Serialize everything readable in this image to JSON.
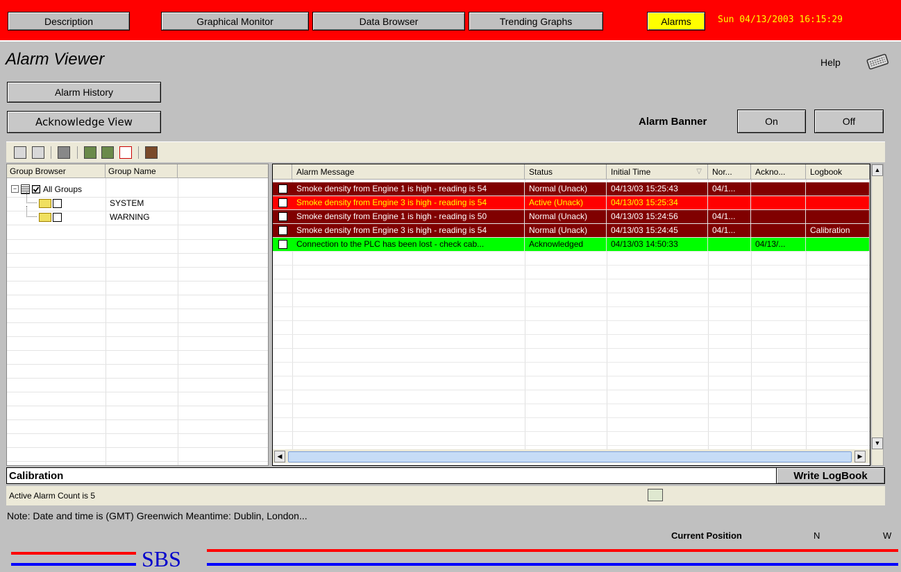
{
  "nav": {
    "tabs": [
      "Description",
      "Graphical Monitor",
      "Data Browser",
      "Trending Graphs"
    ],
    "alarms": "Alarms",
    "clock": "Sun 04/13/2003 16:15:29"
  },
  "header": {
    "title": "Alarm Viewer",
    "help": "Help",
    "alarm_history": "Alarm History",
    "acknowledge_view": "Acknowledge View",
    "alarm_banner": "Alarm Banner",
    "on": "On",
    "off": "Off"
  },
  "groups": {
    "headers": [
      "Group Browser",
      "Group Name"
    ],
    "root": "All Groups",
    "children": [
      "SYSTEM",
      "WARNING"
    ]
  },
  "alarms": {
    "headers": [
      "Alarm Message",
      "Status",
      "Initial Time",
      "Nor...",
      "Ackno...",
      "Logbook"
    ],
    "rows": [
      {
        "message": "Smoke density from Engine 1 is high - reading is 54",
        "status": "Normal (Unack)",
        "initial": "04/13/03 15:25:43",
        "normal": "04/1...",
        "ack": "",
        "logbook": "",
        "bg": "#800000",
        "fg": "#ffffff"
      },
      {
        "message": "Smoke density from Engine 3 is high - reading is 54",
        "status": "Active (Unack)",
        "initial": "04/13/03 15:25:34",
        "normal": "",
        "ack": "",
        "logbook": "",
        "bg": "#ff0000",
        "fg": "#ffff00"
      },
      {
        "message": "Smoke density from Engine 1 is high - reading is 50",
        "status": "Normal (Unack)",
        "initial": "04/13/03 15:24:56",
        "normal": "04/1...",
        "ack": "",
        "logbook": "",
        "bg": "#800000",
        "fg": "#ffffff"
      },
      {
        "message": "Smoke density from Engine 3 is high - reading is 54",
        "status": "Normal (Unack)",
        "initial": "04/13/03 15:24:45",
        "normal": "04/1...",
        "ack": "",
        "logbook": "Calibration",
        "bg": "#800000",
        "fg": "#ffffff"
      },
      {
        "message": "Connection to the PLC has been lost - check cab...",
        "status": "Acknowledged",
        "initial": "04/13/03 14:50:33",
        "normal": "",
        "ack": "04/13/...",
        "logbook": "",
        "bg": "#00ff00",
        "fg": "#000000"
      }
    ]
  },
  "bottom": {
    "logbook_text": "Calibration",
    "write_logbook": "Write LogBook",
    "count": "Active Alarm Count is 5",
    "note": "Note: Date and time is (GMT) Greenwich Meantime: Dublin, London...",
    "current_position": "Current Position",
    "n": "N",
    "w": "W",
    "logo": "SBS"
  }
}
